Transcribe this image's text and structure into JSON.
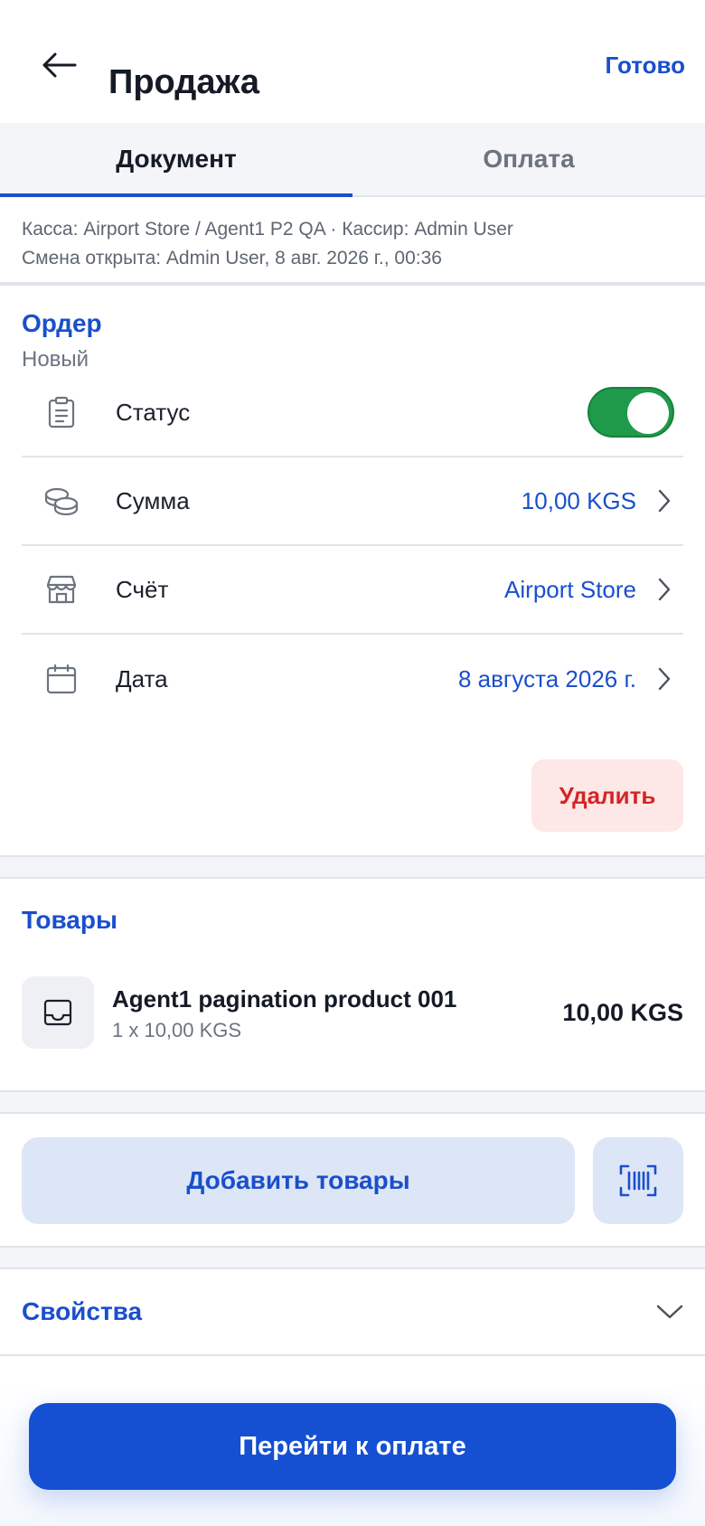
{
  "header": {
    "title": "Продажа",
    "done_label": "Готово"
  },
  "tabs": [
    {
      "label": "Документ",
      "active": true
    },
    {
      "label": "Оплата",
      "active": false
    }
  ],
  "meta": {
    "line1": "Касса: Airport Store / Agent1 P2 QA · Кассир: Admin User",
    "line2": "Смена открыта: Admin User, 8 авг. 2026 г., 00:36"
  },
  "order": {
    "title": "Ордер",
    "subtitle": "Новый",
    "status": {
      "label": "Статус",
      "enabled": true
    },
    "amount": {
      "label": "Сумма",
      "value": "10,00 KGS"
    },
    "account": {
      "label": "Счёт",
      "value": "Airport Store"
    },
    "date": {
      "label": "Дата",
      "value": "8 августа 2026 г."
    },
    "delete_label": "Удалить"
  },
  "goods": {
    "title": "Товары",
    "items": [
      {
        "name": "Agent1 pagination product 001",
        "qty": "1 x 10,00 KGS",
        "price": "10,00 KGS"
      }
    ]
  },
  "actions": {
    "add_label": "Добавить товары"
  },
  "properties": {
    "title": "Свойства"
  },
  "footer": {
    "pay_label": "Перейти к оплате"
  },
  "colors": {
    "accent": "#1a4fcc",
    "toggle_on": "#1f9a4a",
    "danger": "#d42525",
    "danger_bg": "#fde7e7",
    "primary_button": "#1550d2"
  }
}
